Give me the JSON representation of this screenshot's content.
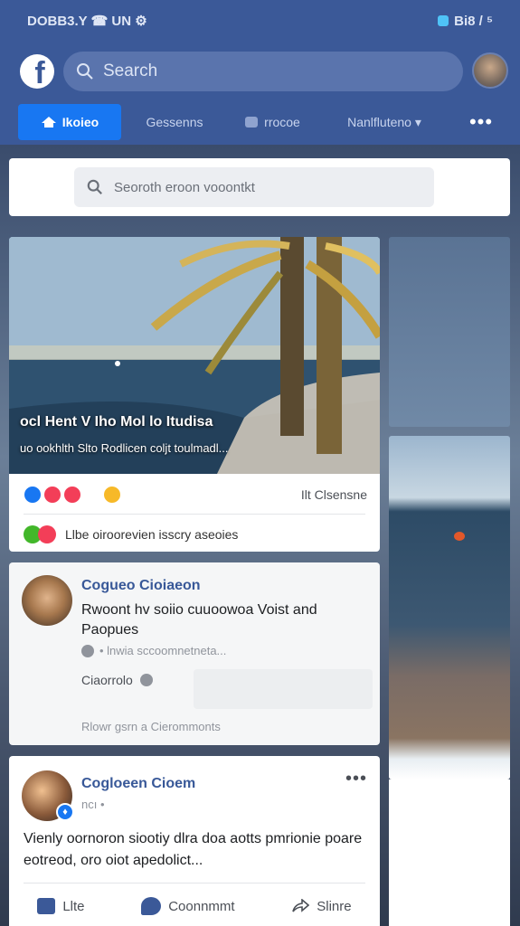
{
  "status": {
    "left": "DOBB3.Y ☎ UN ⚙",
    "right": "Bi8 / ⁵"
  },
  "header": {
    "logo_letter": "f",
    "search_placeholder": "Search"
  },
  "tabs": [
    {
      "label": "Ikoieo",
      "active": true
    },
    {
      "label": "Gessenns"
    },
    {
      "label": "rrocoe"
    },
    {
      "label": "Nanlfluteno ▾"
    },
    {
      "label": "•••"
    }
  ],
  "feed_search": {
    "placeholder": "Seoroth eroon vooontkt"
  },
  "photo_post": {
    "caption_title": "ocl Hent V Iho Mol lo Itudisa",
    "caption_sub": "uo ookhlth Slto Rodlicen coljt toulmadl...",
    "reaction_count": "Ilt Clsensne",
    "like_text": "Llbe oiroorevien isscry aseoies"
  },
  "comment": {
    "name": "Cogueo Cioiaeon",
    "text": "Rwoont hv soiio cuuoowoa Voist and Paopues",
    "meta": "• lnwia sccoomnetneta...",
    "input_label": "Ciaorrolo",
    "write_prompt": "Rlowr gsrn  a  Cierommonts"
  },
  "post": {
    "name": "Cogloeen Cioem",
    "time": "ncı •",
    "more": "•••",
    "text": "Vienly oornoron siootiy dlra doa aotts pmrionie poare eotreod, oro oiot apedolict...",
    "badge": "♦",
    "actions": {
      "like": "Llte",
      "comment": "Coonnmmt",
      "share": "Slinre"
    }
  },
  "colors": {
    "brand": "#3b5998",
    "accent": "#1877f2",
    "link": "#385898"
  }
}
